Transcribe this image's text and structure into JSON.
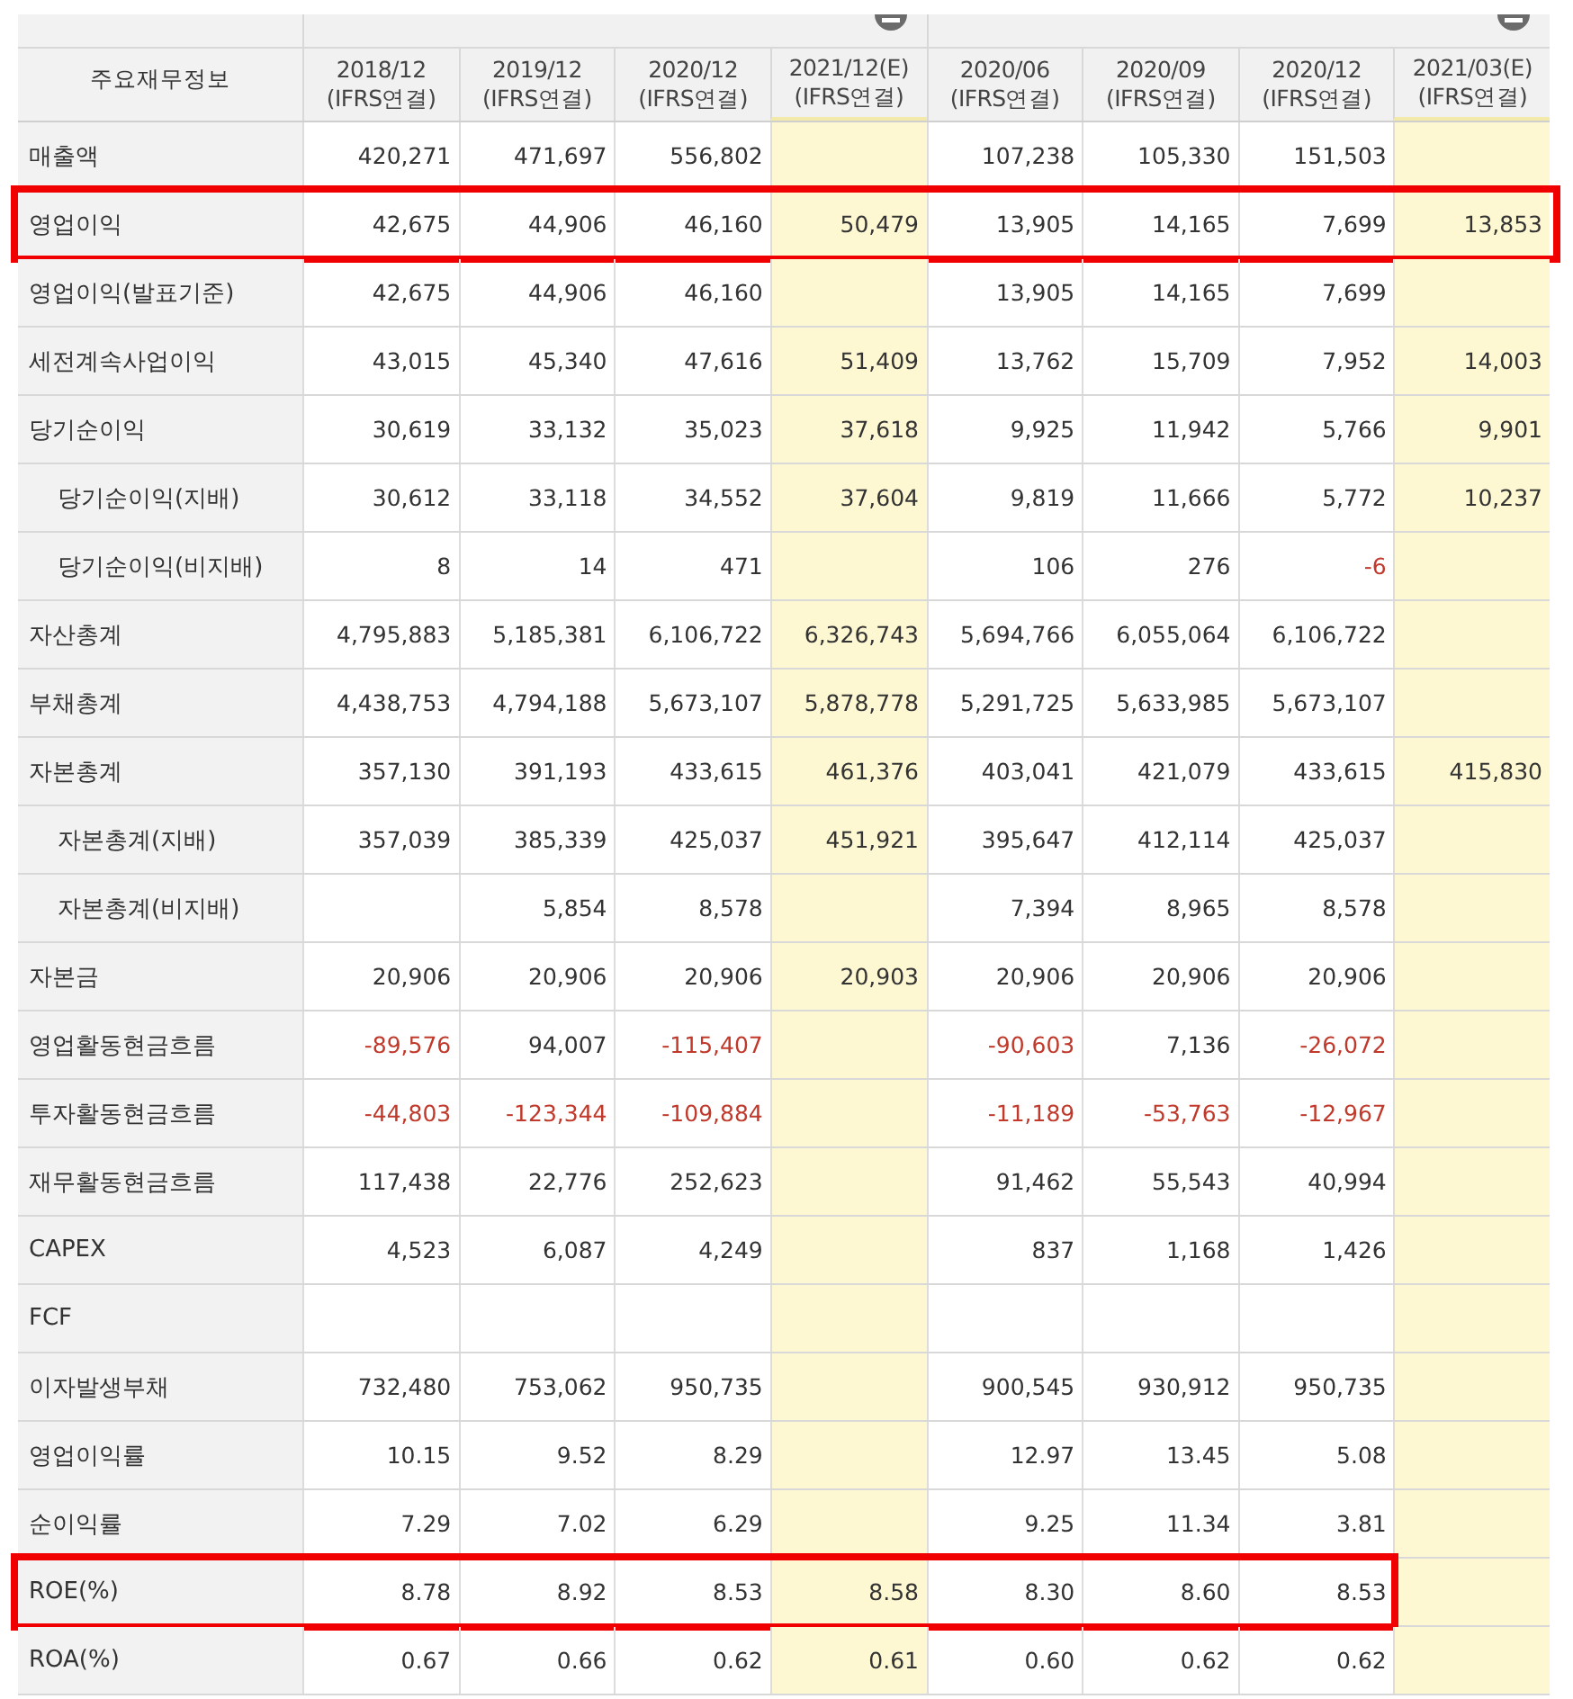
{
  "table": {
    "corner_label": "주요재무정보",
    "column_groups": [
      {
        "collapsible": true,
        "columns": [
          {
            "period": "2018/12",
            "basis": "(IFRS연결)",
            "estimate": false
          },
          {
            "period": "2019/12",
            "basis": "(IFRS연결)",
            "estimate": false
          },
          {
            "period": "2020/12",
            "basis": "(IFRS연결)",
            "estimate": false
          },
          {
            "period": "2021/12(E)",
            "basis": "(IFRS연결)",
            "estimate": true
          }
        ]
      },
      {
        "collapsible": true,
        "columns": [
          {
            "period": "2020/06",
            "basis": "(IFRS연결)",
            "estimate": false
          },
          {
            "period": "2020/09",
            "basis": "(IFRS연결)",
            "estimate": false
          },
          {
            "period": "2020/12",
            "basis": "(IFRS연결)",
            "estimate": false
          },
          {
            "period": "2021/03(E)",
            "basis": "(IFRS연결)",
            "estimate": true
          }
        ]
      }
    ],
    "rows": [
      {
        "label": "매출액",
        "boxed": false,
        "cells": [
          "420,271",
          "471,697",
          "556,802",
          null,
          "107,238",
          "105,330",
          "151,503",
          null
        ]
      },
      {
        "label": "영업이익",
        "boxed": true,
        "box_covers_last_column": true,
        "cells": [
          "42,675",
          "44,906",
          "46,160",
          "50,479",
          "13,905",
          "14,165",
          "7,699",
          "13,853"
        ]
      },
      {
        "label": "영업이익(발표기준)",
        "boxed": false,
        "cells": [
          "42,675",
          "44,906",
          "46,160",
          null,
          "13,905",
          "14,165",
          "7,699",
          null
        ]
      },
      {
        "label": "세전계속사업이익",
        "boxed": false,
        "cells": [
          "43,015",
          "45,340",
          "47,616",
          "51,409",
          "13,762",
          "15,709",
          "7,952",
          "14,003"
        ]
      },
      {
        "label": "당기순이익",
        "boxed": false,
        "cells": [
          "30,619",
          "33,132",
          "35,023",
          "37,618",
          "9,925",
          "11,942",
          "5,766",
          "9,901"
        ],
        "children": [
          {
            "label": "당기순이익(지배)",
            "boxed": false,
            "cells": [
              "30,612",
              "33,118",
              "34,552",
              "37,604",
              "9,819",
              "11,666",
              "5,772",
              "10,237"
            ]
          },
          {
            "label": "당기순이익(비지배)",
            "boxed": false,
            "cells": [
              "8",
              "14",
              "471",
              null,
              "106",
              "276",
              {
                "text": "-6",
                "negative": true
              },
              null
            ]
          }
        ]
      },
      {
        "label": "자산총계",
        "boxed": false,
        "cells": [
          "4,795,883",
          "5,185,381",
          "6,106,722",
          "6,326,743",
          "5,694,766",
          "6,055,064",
          "6,106,722",
          null
        ]
      },
      {
        "label": "부채총계",
        "boxed": false,
        "cells": [
          "4,438,753",
          "4,794,188",
          "5,673,107",
          "5,878,778",
          "5,291,725",
          "5,633,985",
          "5,673,107",
          null
        ]
      },
      {
        "label": "자본총계",
        "boxed": false,
        "cells": [
          "357,130",
          "391,193",
          "433,615",
          "461,376",
          "403,041",
          "421,079",
          "433,615",
          "415,830"
        ],
        "children": [
          {
            "label": "자본총계(지배)",
            "boxed": false,
            "cells": [
              "357,039",
              "385,339",
              "425,037",
              "451,921",
              "395,647",
              "412,114",
              "425,037",
              null
            ]
          },
          {
            "label": "자본총계(비지배)",
            "boxed": false,
            "cells": [
              null,
              "5,854",
              "8,578",
              null,
              "7,394",
              "8,965",
              "8,578",
              null
            ]
          }
        ]
      },
      {
        "label": "자본금",
        "boxed": false,
        "cells": [
          "20,906",
          "20,906",
          "20,906",
          "20,903",
          "20,906",
          "20,906",
          "20,906",
          null
        ]
      },
      {
        "label": "영업활동현금흐름",
        "boxed": false,
        "cells": [
          {
            "text": "-89,576",
            "negative": true
          },
          "94,007",
          {
            "text": "-115,407",
            "negative": true
          },
          null,
          {
            "text": "-90,603",
            "negative": true
          },
          "7,136",
          {
            "text": "-26,072",
            "negative": true
          },
          null
        ]
      },
      {
        "label": "투자활동현금흐름",
        "boxed": false,
        "cells": [
          {
            "text": "-44,803",
            "negative": true
          },
          {
            "text": "-123,344",
            "negative": true
          },
          {
            "text": "-109,884",
            "negative": true
          },
          null,
          {
            "text": "-11,189",
            "negative": true
          },
          {
            "text": "-53,763",
            "negative": true
          },
          {
            "text": "-12,967",
            "negative": true
          },
          null
        ]
      },
      {
        "label": "재무활동현금흐름",
        "boxed": false,
        "cells": [
          "117,438",
          "22,776",
          "252,623",
          null,
          "91,462",
          "55,543",
          "40,994",
          null
        ]
      },
      {
        "label": "CAPEX",
        "boxed": false,
        "cells": [
          "4,523",
          "6,087",
          "4,249",
          null,
          "837",
          "1,168",
          "1,426",
          null
        ]
      },
      {
        "label": "FCF",
        "boxed": false,
        "cells": [
          null,
          null,
          null,
          null,
          null,
          null,
          null,
          null
        ]
      },
      {
        "label": "이자발생부채",
        "boxed": false,
        "cells": [
          "732,480",
          "753,062",
          "950,735",
          null,
          "900,545",
          "930,912",
          "950,735",
          null
        ]
      },
      {
        "label": "영업이익률",
        "boxed": false,
        "cells": [
          "10.15",
          "9.52",
          "8.29",
          null,
          "12.97",
          "13.45",
          "5.08",
          null
        ]
      },
      {
        "label": "순이익률",
        "boxed": false,
        "cells": [
          "7.29",
          "7.02",
          "6.29",
          null,
          "9.25",
          "11.34",
          "3.81",
          null
        ]
      },
      {
        "label": "ROE(%)",
        "boxed": true,
        "box_covers_last_column": false,
        "cells": [
          "8.78",
          "8.92",
          "8.53",
          "8.58",
          "8.30",
          "8.60",
          "8.53",
          null
        ]
      },
      {
        "label": "ROA(%)",
        "boxed": false,
        "cells": [
          "0.67",
          "0.66",
          "0.62",
          "0.61",
          "0.60",
          "0.62",
          "0.62",
          null
        ]
      }
    ]
  }
}
